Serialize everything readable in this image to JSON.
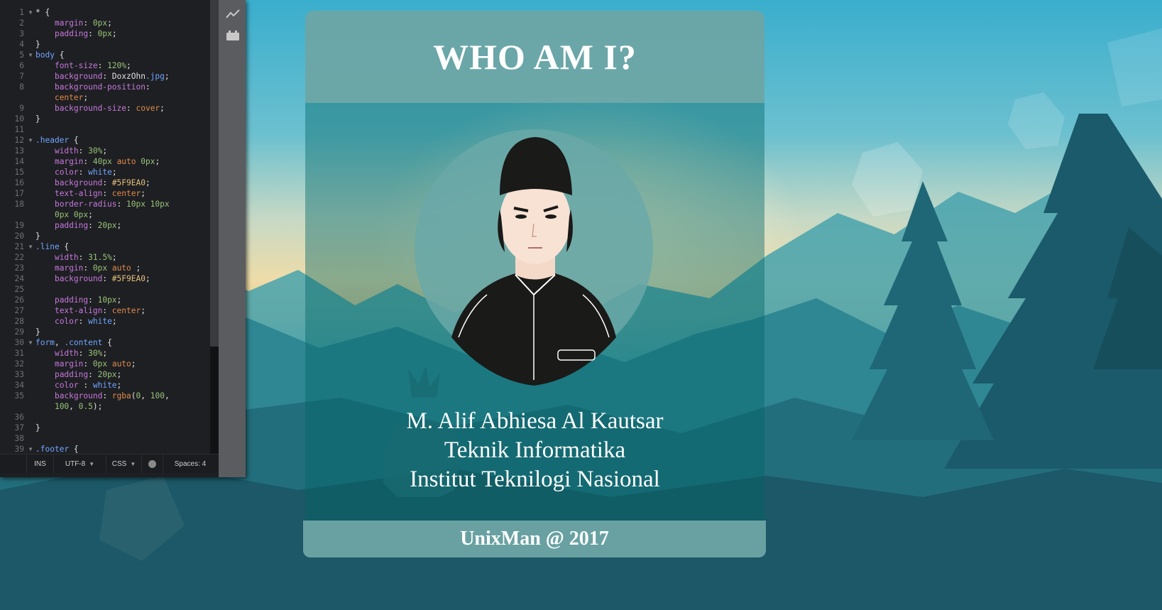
{
  "editor": {
    "lines": [
      {
        "n": "1",
        "fold": "▼",
        "tokens": [
          [
            "plain",
            "* {"
          ]
        ]
      },
      {
        "n": "2",
        "fold": "",
        "tokens": [
          [
            "plain",
            "    "
          ],
          [
            "prop",
            "margin"
          ],
          [
            "plain",
            ": "
          ],
          [
            "val",
            "0px"
          ],
          [
            "plain",
            ";"
          ]
        ]
      },
      {
        "n": "3",
        "fold": "",
        "tokens": [
          [
            "plain",
            "    "
          ],
          [
            "prop",
            "padding"
          ],
          [
            "plain",
            ": "
          ],
          [
            "val",
            "0px"
          ],
          [
            "plain",
            ";"
          ]
        ]
      },
      {
        "n": "4",
        "fold": "",
        "tokens": [
          [
            "plain",
            "}"
          ]
        ]
      },
      {
        "n": "5",
        "fold": "▼",
        "tokens": [
          [
            "sel",
            "body"
          ],
          [
            "plain",
            " {"
          ]
        ]
      },
      {
        "n": "6",
        "fold": "",
        "tokens": [
          [
            "plain",
            "    "
          ],
          [
            "prop",
            "font-size"
          ],
          [
            "plain",
            ": "
          ],
          [
            "val",
            "120%"
          ],
          [
            "plain",
            ";"
          ]
        ]
      },
      {
        "n": "7",
        "fold": "",
        "tokens": [
          [
            "plain",
            "    "
          ],
          [
            "prop",
            "background"
          ],
          [
            "plain",
            ": DoxzOhn"
          ],
          [
            "ext",
            ".jpg"
          ],
          [
            "plain",
            ";"
          ]
        ]
      },
      {
        "n": "8",
        "fold": "",
        "tokens": [
          [
            "plain",
            "    "
          ],
          [
            "prop",
            "background-position"
          ],
          [
            "plain",
            ":"
          ]
        ]
      },
      {
        "n": "",
        "fold": "",
        "tokens": [
          [
            "plain",
            "    "
          ],
          [
            "kw",
            "center"
          ],
          [
            "plain",
            ";"
          ]
        ]
      },
      {
        "n": "9",
        "fold": "",
        "tokens": [
          [
            "plain",
            "    "
          ],
          [
            "prop",
            "background-size"
          ],
          [
            "plain",
            ": "
          ],
          [
            "kw",
            "cover"
          ],
          [
            "plain",
            ";"
          ]
        ]
      },
      {
        "n": "10",
        "fold": "",
        "tokens": [
          [
            "plain",
            "}"
          ]
        ]
      },
      {
        "n": "11",
        "fold": "",
        "tokens": []
      },
      {
        "n": "12",
        "fold": "▼",
        "tokens": [
          [
            "sel",
            ".header"
          ],
          [
            "plain",
            " {"
          ]
        ]
      },
      {
        "n": "13",
        "fold": "",
        "tokens": [
          [
            "plain",
            "    "
          ],
          [
            "prop",
            "width"
          ],
          [
            "plain",
            ": "
          ],
          [
            "val",
            "30%"
          ],
          [
            "plain",
            ";"
          ]
        ]
      },
      {
        "n": "14",
        "fold": "",
        "tokens": [
          [
            "plain",
            "    "
          ],
          [
            "prop",
            "margin"
          ],
          [
            "plain",
            ": "
          ],
          [
            "val",
            "40px"
          ],
          [
            "plain",
            " "
          ],
          [
            "kw",
            "auto"
          ],
          [
            "plain",
            " "
          ],
          [
            "val",
            "0px"
          ],
          [
            "plain",
            ";"
          ]
        ]
      },
      {
        "n": "15",
        "fold": "",
        "tokens": [
          [
            "plain",
            "    "
          ],
          [
            "prop",
            "color"
          ],
          [
            "plain",
            ": "
          ],
          [
            "sel",
            "white"
          ],
          [
            "plain",
            ";"
          ]
        ]
      },
      {
        "n": "16",
        "fold": "",
        "tokens": [
          [
            "plain",
            "    "
          ],
          [
            "prop",
            "background"
          ],
          [
            "plain",
            ": "
          ],
          [
            "str",
            "#5F9EA0"
          ],
          [
            "plain",
            ";"
          ]
        ]
      },
      {
        "n": "17",
        "fold": "",
        "tokens": [
          [
            "plain",
            "    "
          ],
          [
            "prop",
            "text-align"
          ],
          [
            "plain",
            ": "
          ],
          [
            "kw",
            "center"
          ],
          [
            "plain",
            ";"
          ]
        ]
      },
      {
        "n": "18",
        "fold": "",
        "tokens": [
          [
            "plain",
            "    "
          ],
          [
            "prop",
            "border-radius"
          ],
          [
            "plain",
            ": "
          ],
          [
            "val",
            "10px 10px"
          ]
        ]
      },
      {
        "n": "",
        "fold": "",
        "tokens": [
          [
            "plain",
            "    "
          ],
          [
            "val",
            "0px 0px"
          ],
          [
            "plain",
            ";"
          ]
        ]
      },
      {
        "n": "19",
        "fold": "",
        "tokens": [
          [
            "plain",
            "    "
          ],
          [
            "prop",
            "padding"
          ],
          [
            "plain",
            ": "
          ],
          [
            "val",
            "20px"
          ],
          [
            "plain",
            ";"
          ]
        ]
      },
      {
        "n": "20",
        "fold": "",
        "tokens": [
          [
            "plain",
            "}"
          ]
        ]
      },
      {
        "n": "21",
        "fold": "▼",
        "tokens": [
          [
            "sel",
            ".line"
          ],
          [
            "plain",
            " {"
          ]
        ]
      },
      {
        "n": "22",
        "fold": "",
        "tokens": [
          [
            "plain",
            "    "
          ],
          [
            "prop",
            "width"
          ],
          [
            "plain",
            ": "
          ],
          [
            "val",
            "31.5%"
          ],
          [
            "plain",
            ";"
          ]
        ]
      },
      {
        "n": "23",
        "fold": "",
        "tokens": [
          [
            "plain",
            "    "
          ],
          [
            "prop",
            "margin"
          ],
          [
            "plain",
            ": "
          ],
          [
            "val",
            "0px"
          ],
          [
            "plain",
            " "
          ],
          [
            "kw",
            "auto"
          ],
          [
            "plain",
            " ;"
          ]
        ]
      },
      {
        "n": "24",
        "fold": "",
        "tokens": [
          [
            "plain",
            "    "
          ],
          [
            "prop",
            "background"
          ],
          [
            "plain",
            ": "
          ],
          [
            "str",
            "#5F9EA0"
          ],
          [
            "plain",
            ";"
          ]
        ]
      },
      {
        "n": "25",
        "fold": "",
        "tokens": []
      },
      {
        "n": "26",
        "fold": "",
        "tokens": [
          [
            "plain",
            "    "
          ],
          [
            "prop",
            "padding"
          ],
          [
            "plain",
            ": "
          ],
          [
            "val",
            "10px"
          ],
          [
            "plain",
            ";"
          ]
        ]
      },
      {
        "n": "27",
        "fold": "",
        "tokens": [
          [
            "plain",
            "    "
          ],
          [
            "prop",
            "text-align"
          ],
          [
            "plain",
            ": "
          ],
          [
            "kw",
            "center"
          ],
          [
            "plain",
            ";"
          ]
        ]
      },
      {
        "n": "28",
        "fold": "",
        "tokens": [
          [
            "plain",
            "    "
          ],
          [
            "prop",
            "color"
          ],
          [
            "plain",
            ": "
          ],
          [
            "sel",
            "white"
          ],
          [
            "plain",
            ";"
          ]
        ]
      },
      {
        "n": "29",
        "fold": "",
        "tokens": [
          [
            "plain",
            "}"
          ]
        ]
      },
      {
        "n": "30",
        "fold": "▼",
        "tokens": [
          [
            "sel",
            "form"
          ],
          [
            "plain",
            ", "
          ],
          [
            "sel",
            ".content"
          ],
          [
            "plain",
            " {"
          ]
        ]
      },
      {
        "n": "31",
        "fold": "",
        "tokens": [
          [
            "plain",
            "    "
          ],
          [
            "prop",
            "width"
          ],
          [
            "plain",
            ": "
          ],
          [
            "val",
            "30%"
          ],
          [
            "plain",
            ";"
          ]
        ]
      },
      {
        "n": "32",
        "fold": "",
        "tokens": [
          [
            "plain",
            "    "
          ],
          [
            "prop",
            "margin"
          ],
          [
            "plain",
            ": "
          ],
          [
            "val",
            "0px"
          ],
          [
            "plain",
            " "
          ],
          [
            "kw",
            "auto"
          ],
          [
            "plain",
            ";"
          ]
        ]
      },
      {
        "n": "33",
        "fold": "",
        "tokens": [
          [
            "plain",
            "    "
          ],
          [
            "prop",
            "padding"
          ],
          [
            "plain",
            ": "
          ],
          [
            "val",
            "20px"
          ],
          [
            "plain",
            ";"
          ]
        ]
      },
      {
        "n": "34",
        "fold": "",
        "tokens": [
          [
            "plain",
            "    "
          ],
          [
            "prop",
            "color"
          ],
          [
            "plain",
            " : "
          ],
          [
            "sel",
            "white"
          ],
          [
            "plain",
            ";"
          ]
        ]
      },
      {
        "n": "35",
        "fold": "",
        "tokens": [
          [
            "plain",
            "    "
          ],
          [
            "prop",
            "background"
          ],
          [
            "plain",
            ": "
          ],
          [
            "kw",
            "rgba"
          ],
          [
            "plain",
            "("
          ],
          [
            "val",
            "0"
          ],
          [
            "plain",
            ", "
          ],
          [
            "val",
            "100"
          ],
          [
            "plain",
            ","
          ]
        ]
      },
      {
        "n": "",
        "fold": "",
        "tokens": [
          [
            "plain",
            "    "
          ],
          [
            "val",
            "100"
          ],
          [
            "plain",
            ", "
          ],
          [
            "val",
            "0.5"
          ],
          [
            "plain",
            ");"
          ]
        ]
      },
      {
        "n": "36",
        "fold": "",
        "tokens": []
      },
      {
        "n": "37",
        "fold": "",
        "tokens": [
          [
            "plain",
            "}"
          ]
        ]
      },
      {
        "n": "38",
        "fold": "",
        "tokens": []
      },
      {
        "n": "39",
        "fold": "▼",
        "tokens": [
          [
            "sel",
            ".footer"
          ],
          [
            "plain",
            " {"
          ]
        ]
      }
    ],
    "status": {
      "mode": "INS",
      "encoding": "UTF-8",
      "language": "CSS",
      "spaces": "Spaces: 4"
    },
    "icons": [
      "live-preview-icon",
      "extension-manager-icon"
    ]
  },
  "card": {
    "title": "WHO AM I?",
    "name": "M. Alif Abhiesa Al Kautsar",
    "major": "Teknik Informatika",
    "institution": "Institut Teknilogi Nasional",
    "footer": "UnixMan @ 2017"
  },
  "colors": {
    "card_header": "#5F9EA0",
    "content_overlay": "rgba(0, 100, 100, 0.5)",
    "editor_bg": "#1e1f22"
  }
}
